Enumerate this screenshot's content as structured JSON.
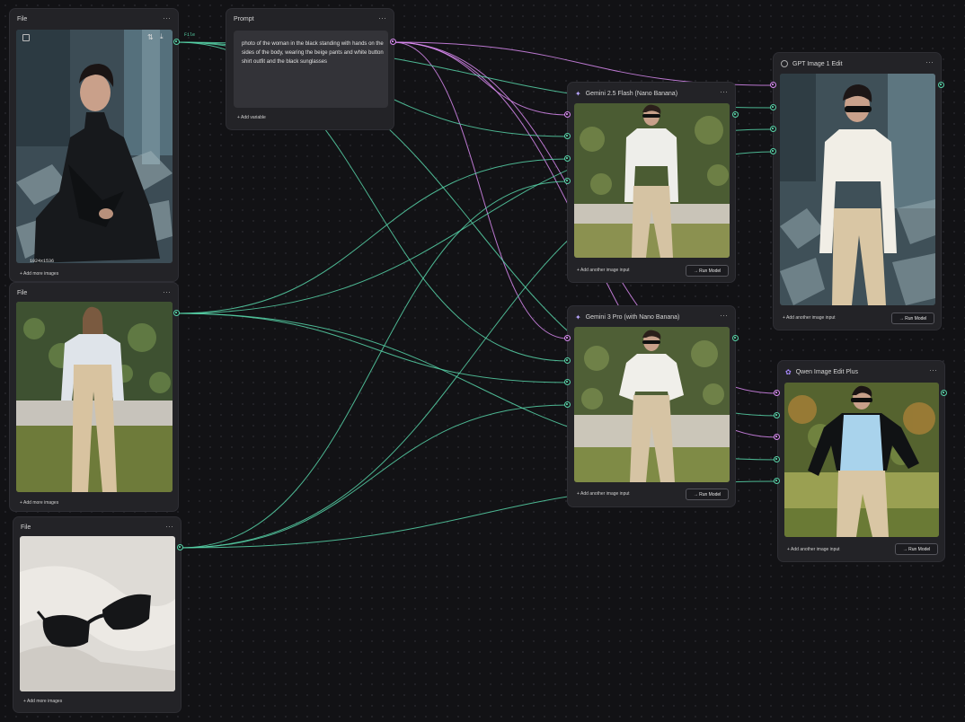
{
  "file_nodes": [
    {
      "title": "File",
      "menu": "···",
      "add_label": "+ Add more images",
      "resolution": "1024x1536",
      "icon": "image-icon",
      "toolbar_icons": [
        "sort-icon",
        "download-icon"
      ]
    },
    {
      "title": "File",
      "menu": "···",
      "add_label": "+ Add more images"
    },
    {
      "title": "File",
      "menu": "···",
      "add_label": "+ Add more images"
    }
  ],
  "wire_label": "File",
  "prompt_node": {
    "title": "Prompt",
    "menu": "···",
    "text": "photo of the woman in the black standing with hands on the sides of the body, wearing the beige pants and white button shirt outfit and the black sunglasses",
    "add_variable": "Add variable"
  },
  "model_nodes": [
    {
      "title": "Gemini 2.5 Flash (Nano Banana)",
      "menu": "···",
      "add_input": "Add another image input",
      "run": "Run Model",
      "icon": "sparkle-icon"
    },
    {
      "title": "Gemini 3 Pro (with Nano Banana)",
      "menu": "···",
      "add_input": "Add another image input",
      "run": "Run Model",
      "icon": "sparkle-icon"
    },
    {
      "title": "GPT Image 1 Edit",
      "menu": "···",
      "add_input": "Add another image input",
      "run": "Run Model",
      "icon": "openai-icon"
    },
    {
      "title": "Qwen Image Edit Plus",
      "menu": "···",
      "add_input": "Add another image input",
      "run": "Run Model",
      "icon": "qwen-icon"
    }
  ],
  "colors": {
    "wire_green": "#57d3a8",
    "wire_purple": "#d88af0",
    "canvas": "#121215",
    "node": "#232327"
  }
}
